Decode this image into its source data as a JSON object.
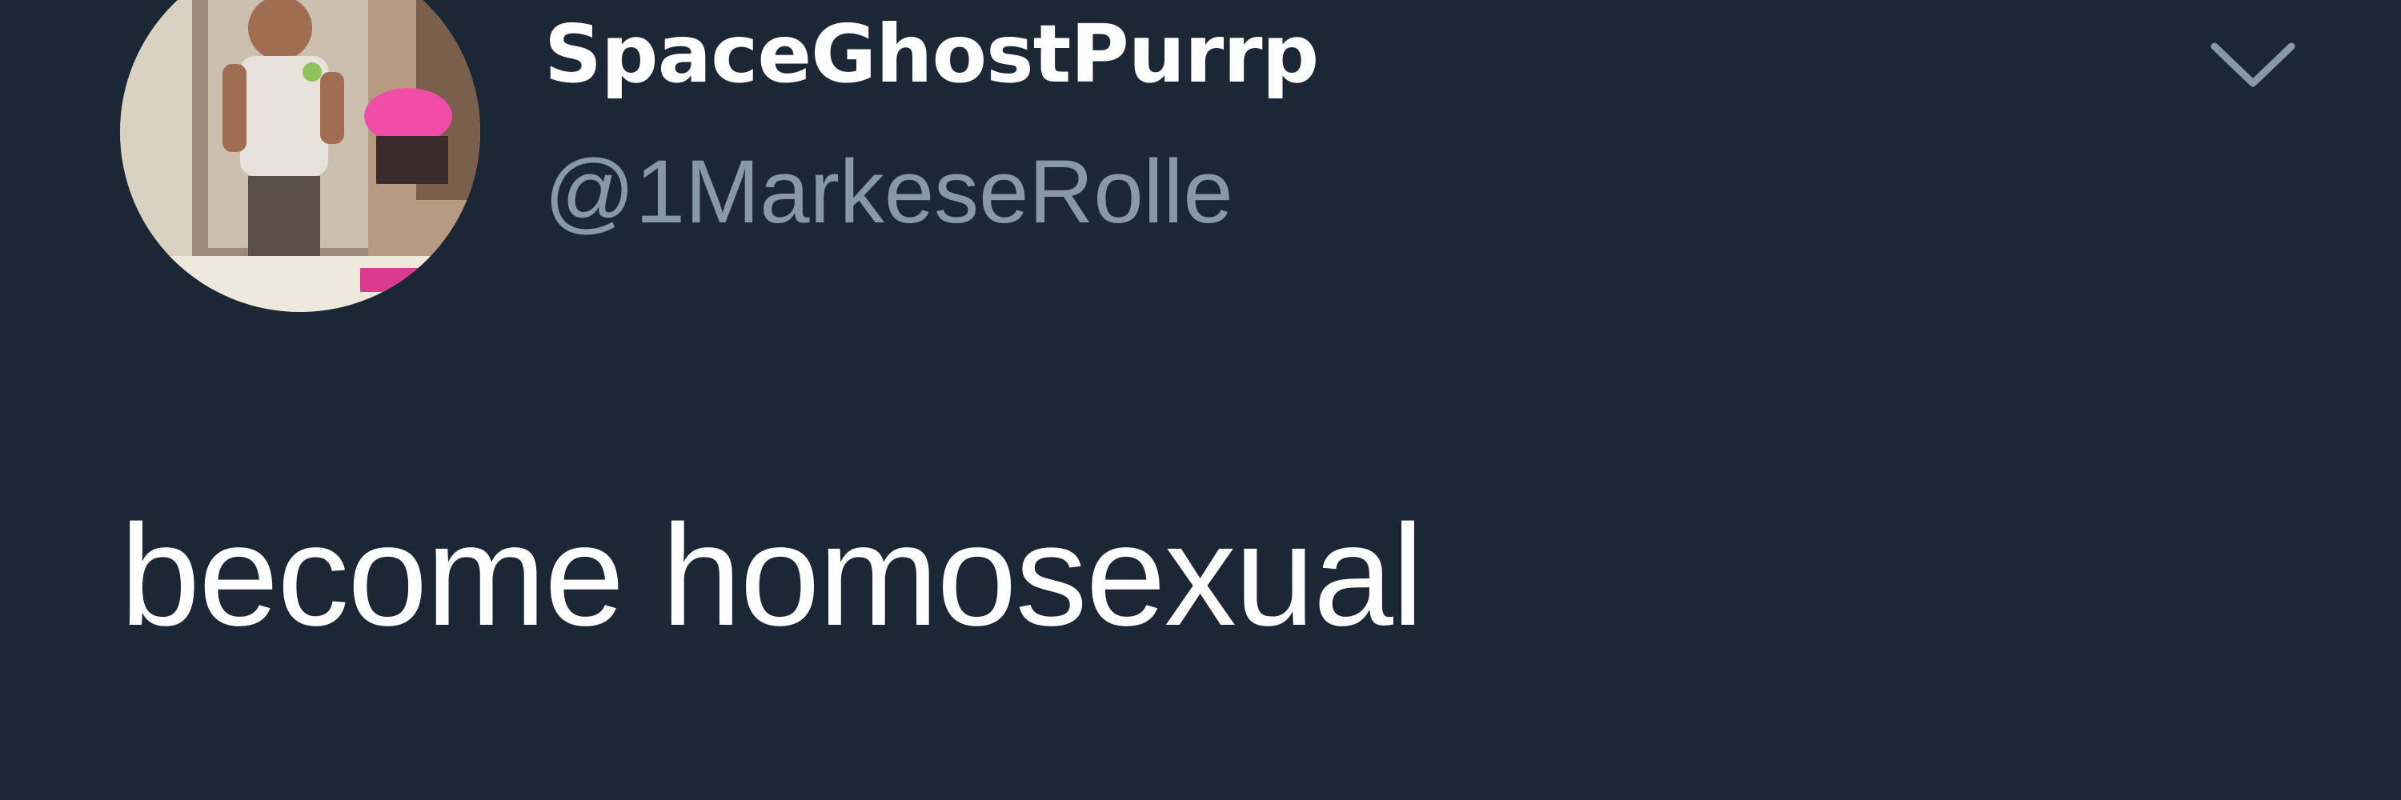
{
  "tweet": {
    "author": {
      "display_name": "SpaceGhostPurrp",
      "handle": "@1MarkeseRolle",
      "avatar": "profile-photo"
    },
    "menu_icon": "chevron-down-icon",
    "text": "become homosexual"
  },
  "colors": {
    "background": "#1c2735",
    "name": "#ffffff",
    "handle": "#8899a6",
    "text": "#ffffff"
  }
}
